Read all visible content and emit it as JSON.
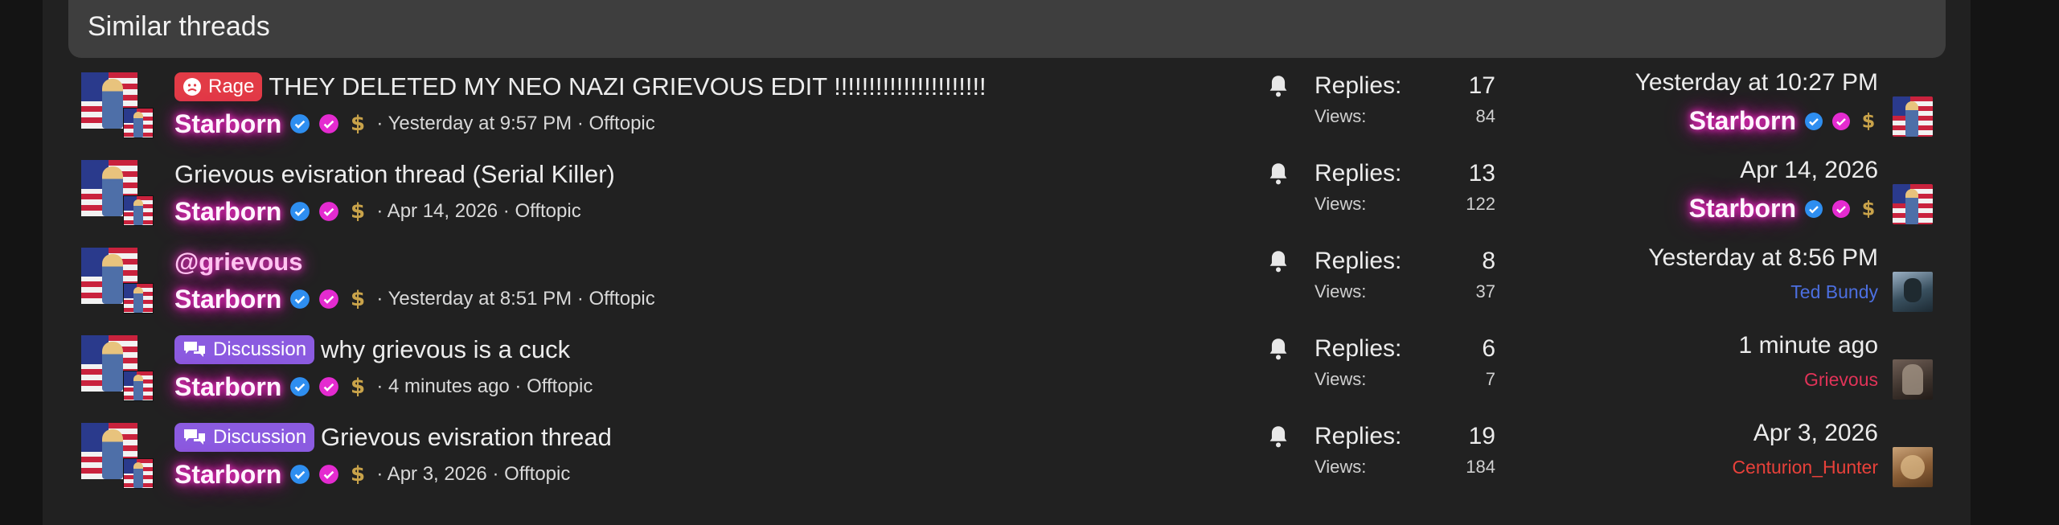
{
  "section": {
    "title": "Similar threads"
  },
  "labels": {
    "replies": "Replies:",
    "views": "Views:"
  },
  "threads": [
    {
      "prefix": "Rage",
      "title": "THEY DELETED MY NEO NAZI GRIEVOUS EDIT !!!!!!!!!!!!!!!!!!!!!!",
      "author": "Starborn",
      "meta": "· Yesterday at 9:57 PM · Offtopic",
      "replies": "17",
      "views": "84",
      "last_date": "Yesterday at 10:27 PM",
      "last_user": "Starborn"
    },
    {
      "prefix": "",
      "title": "Grievous evisration thread (Serial Killer)",
      "author": "Starborn",
      "meta": "· Apr 14, 2026 · Offtopic",
      "replies": "13",
      "views": "122",
      "last_date": "Apr 14, 2026",
      "last_user": "Starborn"
    },
    {
      "prefix": "",
      "title": "@grievous",
      "author": "Starborn",
      "meta": "· Yesterday at 8:51 PM · Offtopic",
      "replies": "8",
      "views": "37",
      "last_date": "Yesterday at 8:56 PM",
      "last_user": "Ted Bundy"
    },
    {
      "prefix": "Discussion",
      "title": "why grievous is a cuck",
      "author": "Starborn",
      "meta": "· 4 minutes ago · Offtopic",
      "replies": "6",
      "views": "7",
      "last_date": "1 minute ago",
      "last_user": "Grievous"
    },
    {
      "prefix": "Discussion",
      "title": "Grievous evisration thread",
      "author": "Starborn",
      "meta": "· Apr 3, 2026 · Offtopic",
      "replies": "19",
      "views": "184",
      "last_date": "Apr 3, 2026",
      "last_user": "Centurion_Hunter"
    }
  ],
  "colors": {
    "rage_badge": "#e23b46",
    "discussion_badge": "#8b5be0",
    "starborn_glow": "#ff2fd0",
    "ted_bundy": "#4c6fe0",
    "grievous": "#e13358",
    "centurion_hunter": "#e8413a"
  },
  "icons": [
    "bell-icon",
    "verified-icon",
    "pink-badge-icon",
    "dollar-icon",
    "angry-face-icon",
    "chat-bubbles-icon"
  ]
}
